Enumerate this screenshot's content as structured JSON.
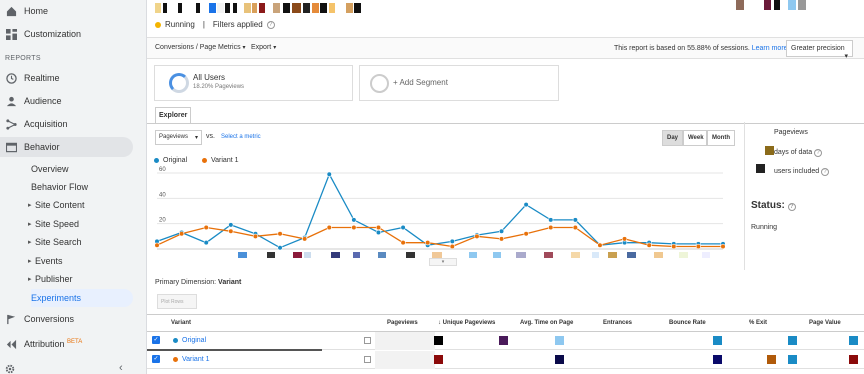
{
  "sidebar": {
    "top_items": [
      {
        "label": "Home",
        "icon": "home-icon"
      },
      {
        "label": "Customization",
        "icon": "dashboard-icon"
      }
    ],
    "section_label": "REPORTS",
    "report_items": [
      {
        "label": "Realtime",
        "icon": "clock-icon"
      },
      {
        "label": "Audience",
        "icon": "person-icon"
      },
      {
        "label": "Acquisition",
        "icon": "acquisition-icon"
      },
      {
        "label": "Behavior",
        "icon": "behavior-icon"
      }
    ],
    "behavior_sub": [
      {
        "label": "Overview",
        "caret": false
      },
      {
        "label": "Behavior Flow",
        "caret": false
      },
      {
        "label": "Site Content",
        "caret": true
      },
      {
        "label": "Site Speed",
        "caret": true
      },
      {
        "label": "Site Search",
        "caret": true
      },
      {
        "label": "Events",
        "caret": true
      },
      {
        "label": "Publisher",
        "caret": true
      },
      {
        "label": "Experiments",
        "caret": false
      }
    ],
    "bottom_items": [
      {
        "label": "Conversions",
        "icon": "flag-icon"
      },
      {
        "label": "Attribution",
        "icon": "attribution-icon",
        "badge": "BETA"
      }
    ]
  },
  "header": {
    "status": "Running",
    "separator": "|",
    "filters": "Filters applied"
  },
  "toolbar": {
    "menu1": "Conversions / Page Metrics",
    "menu2": "Export",
    "note": "This report is based on 55.88% of sessions.",
    "learn_more": "Learn more",
    "precision": "Greater precision"
  },
  "segments": {
    "all_users_title": "All Users",
    "all_users_sub": "18.20% Pageviews",
    "add_segment": "+ Add Segment"
  },
  "explorer": {
    "tab": "Explorer",
    "metric": "Pageviews",
    "vs": "vs.",
    "select_metric": "Select a metric",
    "periods": [
      "Day",
      "Week",
      "Month"
    ]
  },
  "chart_data": {
    "type": "line",
    "title": "",
    "xlabel": "",
    "ylabel": "",
    "ylim": [
      0,
      60
    ],
    "yticks": [
      "60",
      "40",
      "20"
    ],
    "x": [
      1,
      2,
      3,
      4,
      5,
      6,
      7,
      8,
      9,
      10,
      11,
      12,
      13,
      14,
      15,
      16,
      17,
      18,
      19,
      20,
      21,
      22,
      23,
      24
    ],
    "series": [
      {
        "name": "Original",
        "color": "#1a8bc5",
        "values": [
          6,
          13,
          5,
          19,
          12,
          1,
          9,
          59,
          23,
          13,
          17,
          3,
          6,
          11,
          14,
          35,
          23,
          23,
          3,
          5,
          5,
          4,
          4,
          4
        ]
      },
      {
        "name": "Variant 1",
        "color": "#e8710a",
        "values": [
          3,
          12,
          17,
          14,
          10,
          12,
          8,
          17,
          17,
          17,
          5,
          5,
          2,
          10,
          8,
          12,
          17,
          17,
          3,
          8,
          3,
          2,
          2,
          2
        ]
      }
    ]
  },
  "right_panel": {
    "pageviews_label": "Pageviews",
    "days_label": "days of data",
    "users_label": "users included",
    "status_title": "Status:",
    "status_value": "Running"
  },
  "table": {
    "primary_label": "Primary Dimension:",
    "primary_value": "Variant",
    "plot_rows": "Plot Rows",
    "headers": [
      "Variant",
      "Pageviews",
      "Unique Pageviews",
      "Avg. Time on Page",
      "Entrances",
      "Bounce Rate",
      "% Exit",
      "Page Value"
    ],
    "rows": [
      {
        "name": "Original",
        "dot_color": "#1a8bc5"
      },
      {
        "name": "Variant 1",
        "dot_color": "#e8710a"
      }
    ]
  }
}
